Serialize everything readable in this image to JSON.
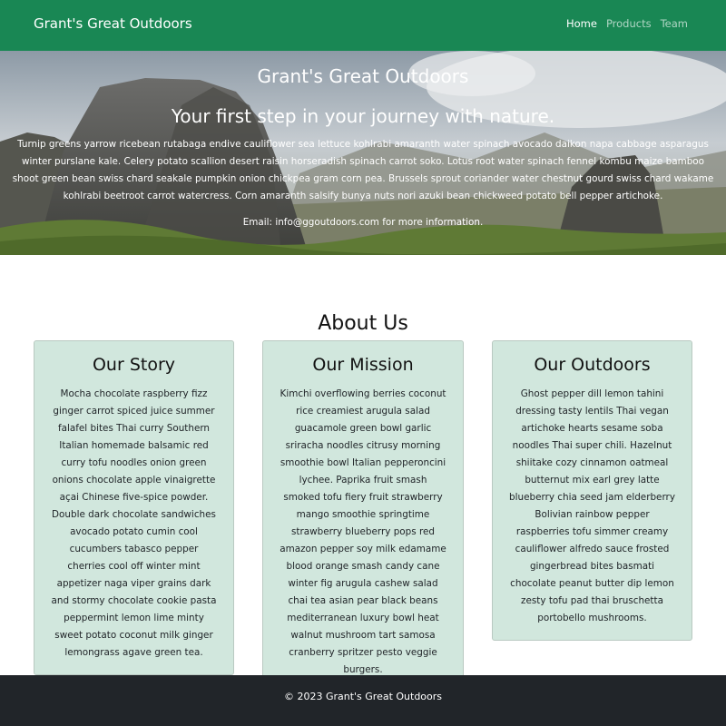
{
  "navbar": {
    "brand": "Grant's Great Outdoors",
    "links": [
      {
        "label": "Home"
      },
      {
        "label": "Products"
      },
      {
        "label": "Team"
      }
    ]
  },
  "hero": {
    "title": "Grant's Great Outdoors",
    "subtitle": "Your first step in your journey with nature.",
    "text": "Turnip greens yarrow ricebean rutabaga endive cauliflower sea lettuce kohlrabi amaranth water spinach avocado daikon napa cabbage asparagus winter purslane kale. Celery potato scallion desert raisin horseradish spinach carrot soko. Lotus root water spinach fennel kombu maize bamboo shoot green bean swiss chard seakale pumpkin onion chickpea gram corn pea. Brussels sprout coriander water chestnut gourd swiss chard wakame kohlrabi beetroot carrot watercress. Corn amaranth salsify bunya nuts nori azuki bean chickweed potato bell pepper artichoke.",
    "email": "Email: info@ggoutdoors.com for more information."
  },
  "about": {
    "heading": "About Us",
    "cards": [
      {
        "title": "Our Story",
        "text": "Mocha chocolate raspberry fizz ginger carrot spiced juice summer falafel bites Thai curry Southern Italian homemade balsamic red curry tofu noodles onion green onions chocolate apple vinaigrette açai Chinese five-spice powder. Double dark chocolate sandwiches avocado potato cumin cool cucumbers tabasco pepper cherries cool off winter mint appetizer naga viper grains dark and stormy chocolate cookie pasta peppermint lemon lime minty sweet potato coconut milk ginger lemongrass agave green tea."
      },
      {
        "title": "Our Mission",
        "text": "Kimchi overflowing berries coconut rice creamiest arugula salad guacamole green bowl garlic sriracha noodles citrusy morning smoothie bowl Italian pepperoncini lychee. Paprika fruit smash smoked tofu fiery fruit strawberry mango smoothie springtime strawberry blueberry pops red amazon pepper soy milk edamame blood orange smash candy cane winter fig arugula cashew salad chai tea asian pear black beans mediterranean luxury bowl heat walnut mushroom tart samosa cranberry spritzer pesto veggie burgers."
      },
      {
        "title": "Our Outdoors",
        "text": "Ghost pepper dill lemon tahini dressing tasty lentils Thai vegan artichoke hearts sesame soba noodles Thai super chili. Hazelnut shiitake cozy cinnamon oatmeal butternut mix earl grey latte blueberry chia seed jam elderberry Bolivian rainbow pepper raspberries tofu simmer creamy cauliflower alfredo sauce frosted gingerbread bites basmati chocolate peanut butter dip lemon zesty tofu pad thai bruschetta portobello mushrooms."
      }
    ]
  },
  "footer": {
    "text": "© 2023 Grant's Great Outdoors"
  },
  "colors": {
    "navbar": "#198754",
    "card_bg": "#d1e7dd",
    "footer": "#212529"
  }
}
